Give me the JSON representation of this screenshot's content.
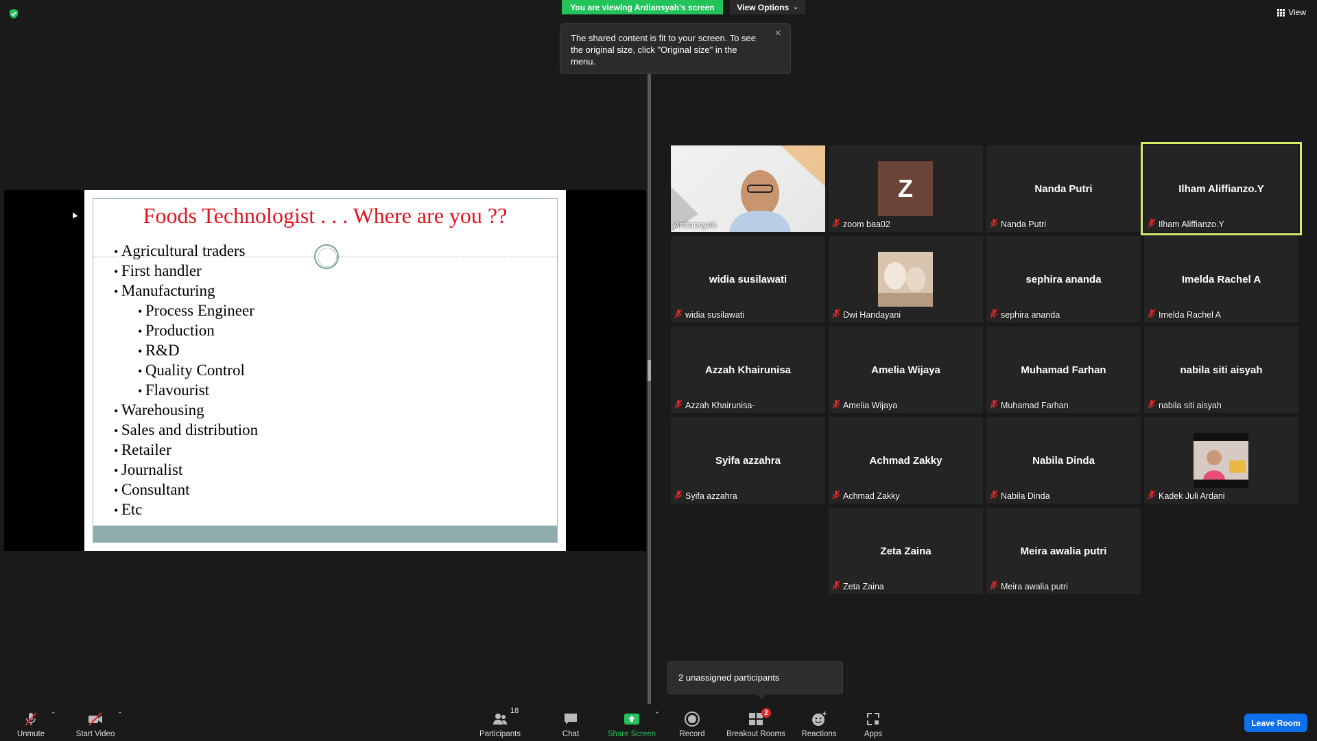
{
  "banner": {
    "viewing_text": "You are viewing Ardiansyah's screen",
    "view_options": "View Options"
  },
  "tooltip": {
    "text": "The shared content is fit to your screen. To see the original size, click \"Original size\" in the menu."
  },
  "view_button": "View",
  "slide": {
    "title": "Foods Technologist . . . Where are you ??",
    "bullets": [
      {
        "text": "Agricultural traders",
        "level": 1
      },
      {
        "text": "First handler",
        "level": 1
      },
      {
        "text": "Manufacturing",
        "level": 1
      },
      {
        "text": "Process Engineer",
        "level": 2
      },
      {
        "text": "Production",
        "level": 2
      },
      {
        "text": "R&D",
        "level": 2
      },
      {
        "text": "Quality Control",
        "level": 2
      },
      {
        "text": "Flavourist",
        "level": 2
      },
      {
        "text": "Warehousing",
        "level": 1
      },
      {
        "text": "Sales and distribution",
        "level": 1
      },
      {
        "text": "Retailer",
        "level": 1
      },
      {
        "text": "Journalist",
        "level": 1
      },
      {
        "text": "Consultant",
        "level": 1
      },
      {
        "text": "Etc",
        "level": 1
      }
    ]
  },
  "participants": [
    {
      "name": "",
      "label": "Ardiansyah",
      "type": "video",
      "muted": false
    },
    {
      "name": "",
      "label": "zoom baa02",
      "type": "avatar",
      "initial": "Z",
      "muted": true
    },
    {
      "name": "Nanda Putri",
      "label": "Nanda Putri",
      "type": "name",
      "muted": true
    },
    {
      "name": "Ilham Aliffianzo.Y",
      "label": "Ilham Aliffianzo.Y",
      "type": "name",
      "muted": true,
      "active": true
    },
    {
      "name": "widia susilawati",
      "label": "widia susilawati",
      "type": "name",
      "muted": true
    },
    {
      "name": "",
      "label": "Dwi Handayani",
      "type": "photo",
      "muted": true
    },
    {
      "name": "sephira ananda",
      "label": "sephira ananda",
      "type": "name",
      "muted": true
    },
    {
      "name": "Imelda Rachel A",
      "label": "Imelda Rachel A",
      "type": "name",
      "muted": true
    },
    {
      "name": "Azzah Khairunisa",
      "label": "Azzah Khairunisa-",
      "type": "name",
      "muted": true
    },
    {
      "name": "Amelia Wijaya",
      "label": "Amelia Wijaya",
      "type": "name",
      "muted": true
    },
    {
      "name": "Muhamad Farhan",
      "label": "Muhamad Farhan",
      "type": "name",
      "muted": true
    },
    {
      "name": "nabila siti aisyah",
      "label": "nabila siti aisyah",
      "type": "name",
      "muted": true
    },
    {
      "name": "Syifa azzahra",
      "label": "Syifa azzahra",
      "type": "name",
      "muted": true
    },
    {
      "name": "Achmad Zakky",
      "label": "Achmad Zakky",
      "type": "name",
      "muted": true
    },
    {
      "name": "Nabila Dinda",
      "label": "Nabila Dinda",
      "type": "name",
      "muted": true
    },
    {
      "name": "",
      "label": "Kadek Juli Ardani",
      "type": "photo2",
      "muted": true
    },
    {
      "name": "Zeta Zaina",
      "label": "Zeta Zaina",
      "type": "name",
      "muted": true
    },
    {
      "name": "Meira awalia putri",
      "label": "Meira awalia putri",
      "type": "name",
      "muted": true
    }
  ],
  "unassigned": "2 unassigned participants",
  "toolbar": {
    "unmute": "Unmute",
    "start_video": "Start Video",
    "participants": "Participants",
    "participants_count": "18",
    "chat": "Chat",
    "share_screen": "Share Screen",
    "record": "Record",
    "breakout_rooms": "Breakout Rooms",
    "breakout_count": "2",
    "reactions": "Reactions",
    "apps": "Apps",
    "leave_room": "Leave Room"
  },
  "colors": {
    "banner_green": "#23c35b",
    "active_speaker": "#d7eb6b",
    "leave_blue": "#0e71eb",
    "slide_title_red": "#e0141e",
    "mic_off_red": "#e02828"
  }
}
